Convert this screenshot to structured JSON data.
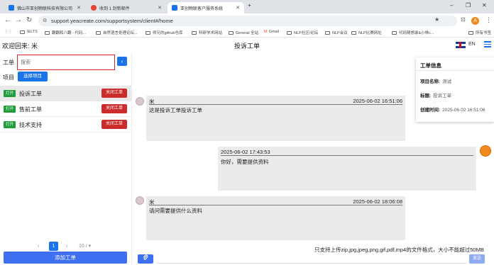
{
  "browser": {
    "tabs": [
      {
        "label": "佛山市亚创物联科技有限公司",
        "favicon_color": "#1a73e8"
      },
      {
        "label": "收到 1 封新邮件",
        "favicon_color": "#ea4335"
      },
      {
        "label": "亚创物联客户服务系统",
        "favicon_color": "#1a73e8"
      }
    ],
    "new_tab": "+",
    "url": "support.yeacreate.com/supportsystem/client#/home",
    "profile_initial": "A",
    "bookmarks": [
      "IELTS",
      "翻翻和八翻 - 代码...",
      "自然语言处理论坛...",
      "师兄的github仓库",
      "科研学术网站",
      "General 全站",
      "Gmail",
      "NLP社区/论坛",
      "NLP会议",
      "NLP比赛网址",
      "代码随想录&小林c...",
      "所有书签"
    ]
  },
  "header": {
    "welcome": "欢迎回来: 米",
    "title": "投诉工单",
    "lang": "EN"
  },
  "sidebar": {
    "ticket_label": "工单",
    "search_placeholder": "搜索",
    "collapse_icon": "‹",
    "project_label": "项目",
    "select_project": "选择项目",
    "tickets": [
      {
        "status": "打开",
        "name": "投诉工单",
        "action": "关闭工单"
      },
      {
        "status": "打开",
        "name": "售前工单",
        "action": "关闭工单"
      },
      {
        "status": "打开",
        "name": "技术支持",
        "action": "关闭工单"
      }
    ],
    "pager": {
      "prev": "‹",
      "current": "1",
      "next": "›",
      "size": "10 / ▾"
    },
    "add_button": "添加工单"
  },
  "messages": [
    {
      "sender": "米",
      "time": "2025-06-02 16:51:06",
      "text": "这是投诉工单投诉工单"
    },
    {
      "sender": "",
      "time": "2025-06-02 17:43:53",
      "text": "你好，需要提供资料"
    },
    {
      "sender": "米",
      "time": "2025-06-02 18:06:08",
      "text": "请问需要提供什么资料"
    }
  ],
  "info": {
    "title": "工单信息",
    "project_key": "项目名称:",
    "project_val": "测试",
    "tag_key": "标题:",
    "tag_val": "投诉工单",
    "created_key": "创建时间:",
    "created_val": "2025-06-02 16:51:06"
  },
  "composer": {
    "upload_note": "只支持上传zip,jpg,jpeg,png,gif,pdf,mp4的文件格式，大小不能超过50MB",
    "attach_icon": "⌕",
    "send_label": "发送"
  },
  "colors": {
    "accent": "#1a73e8",
    "danger": "#cc2b2b",
    "success": "#1f9d3a",
    "bubble": "#ebebeb"
  }
}
